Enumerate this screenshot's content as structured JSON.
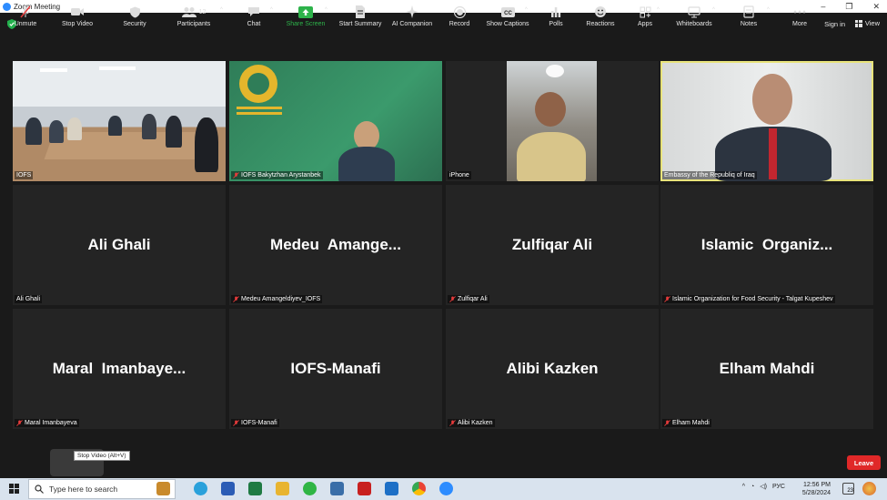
{
  "window": {
    "title": "Zoom Meeting",
    "min": "–",
    "restore": "❐",
    "close": "✕"
  },
  "topbar": {
    "sign_in": "Sign in",
    "view": "View"
  },
  "tiles": [
    {
      "id": "iofs",
      "label": "IOFS",
      "muted": false,
      "video": true
    },
    {
      "id": "bakytzhan",
      "label": "IOFS Bakytzhan Arystanbek",
      "muted": true,
      "video": true
    },
    {
      "id": "iphone",
      "label": "iPhone",
      "muted": false,
      "video": true
    },
    {
      "id": "iraq",
      "label": "Embassy of the Republiq of Iraq",
      "muted": false,
      "video": true
    },
    {
      "id": "ali",
      "big": "Ali Ghali",
      "label": "Ali Ghali",
      "muted": false
    },
    {
      "id": "medeu",
      "big": "Medeu  Amange...",
      "label": "Medeu Amangeldiyev_IOFS",
      "muted": true
    },
    {
      "id": "zulfiqar",
      "big": "Zulfiqar Ali",
      "label": "Zulfiqar Ali",
      "muted": true
    },
    {
      "id": "islamic",
      "big": "Islamic  Organiz...",
      "label": "Islamic Organization for Food Security - Talgat Kupeshev",
      "muted": true
    },
    {
      "id": "maral",
      "big": "Maral  Imanbaye...",
      "label": "Maral Imanbayeva",
      "muted": true
    },
    {
      "id": "manafi",
      "big": "IOFS-Manafi",
      "label": "IOFS-Manafi",
      "muted": true
    },
    {
      "id": "alibi",
      "big": "Alibi Kazken",
      "label": "Alibi Kazken",
      "muted": true
    },
    {
      "id": "elham",
      "big": "Elham Mahdi",
      "label": "Elham Mahdi",
      "muted": true
    }
  ],
  "toolbar": {
    "unmute": "Unmute",
    "stop_video": "Stop Video",
    "tooltip": "Stop Video (Alt+V)",
    "security": "Security",
    "participants": "Participants",
    "participants_count": "12",
    "chat": "Chat",
    "share_screen": "Share Screen",
    "start_summary": "Start Summary",
    "ai_companion": "AI Companion",
    "record": "Record",
    "show_captions": "Show Captions",
    "polls": "Polls",
    "reactions": "Reactions",
    "apps": "Apps",
    "whiteboards": "Whiteboards",
    "notes": "Notes",
    "more": "More",
    "leave": "Leave",
    "share_color": "#2db34a",
    "leave_color": "#e02828"
  },
  "taskbar": {
    "search_placeholder": "Type here to search",
    "lang": "РУС",
    "time": "12:56 PM",
    "date": "5/28/2024",
    "notif_count": "23"
  }
}
